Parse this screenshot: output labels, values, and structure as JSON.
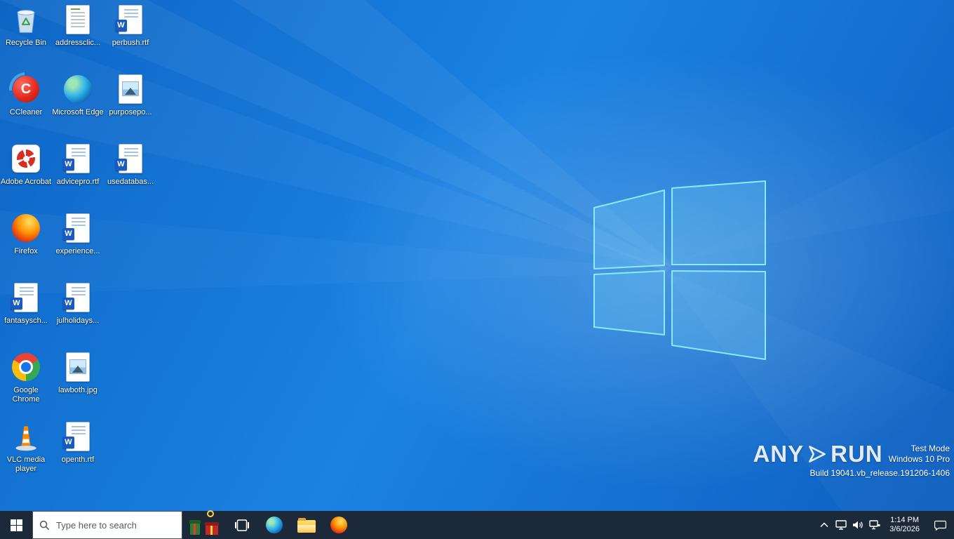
{
  "desktop": {
    "icons": [
      {
        "label": "Recycle Bin",
        "icon": "recycle-bin-icon"
      },
      {
        "label": "addressclic...",
        "icon": "text-document-icon"
      },
      {
        "label": "perbush.rtf",
        "icon": "word-document-icon"
      },
      {
        "label": "CCleaner",
        "icon": "ccleaner-icon"
      },
      {
        "label": "Microsoft Edge",
        "icon": "edge-icon"
      },
      {
        "label": "purposepo...",
        "icon": "image-file-icon"
      },
      {
        "label": "Adobe Acrobat",
        "icon": "acrobat-icon"
      },
      {
        "label": "advicepro.rtf",
        "icon": "word-document-icon"
      },
      {
        "label": "usedatabas...",
        "icon": "word-document-icon"
      },
      {
        "label": "Firefox",
        "icon": "firefox-icon"
      },
      {
        "label": "experience...",
        "icon": "word-document-icon"
      },
      {
        "label": "fantasysch...",
        "icon": "word-document-icon"
      },
      {
        "label": "julholidays...",
        "icon": "word-document-icon"
      },
      {
        "label": "Google Chrome",
        "icon": "chrome-icon"
      },
      {
        "label": "lawboth.jpg",
        "icon": "image-file-icon"
      },
      {
        "label": "VLC media player",
        "icon": "vlc-icon"
      },
      {
        "label": "openth.rtf",
        "icon": "word-document-icon"
      }
    ]
  },
  "watermark": {
    "logo_left": "ANY",
    "logo_right": "RUN",
    "lines": [
      "Test Mode",
      "Windows 10 Pro",
      "Build 19041.vb_release.191206-1406"
    ]
  },
  "taskbar": {
    "search_placeholder": "Type here to search",
    "clock": {
      "time": "1:14 PM",
      "date": "3/6/2026"
    }
  },
  "colors": {
    "taskbar_bg": "#1c2938",
    "wallpaper_blue": "#1b82e2",
    "logo_stroke": "#86ecff"
  }
}
